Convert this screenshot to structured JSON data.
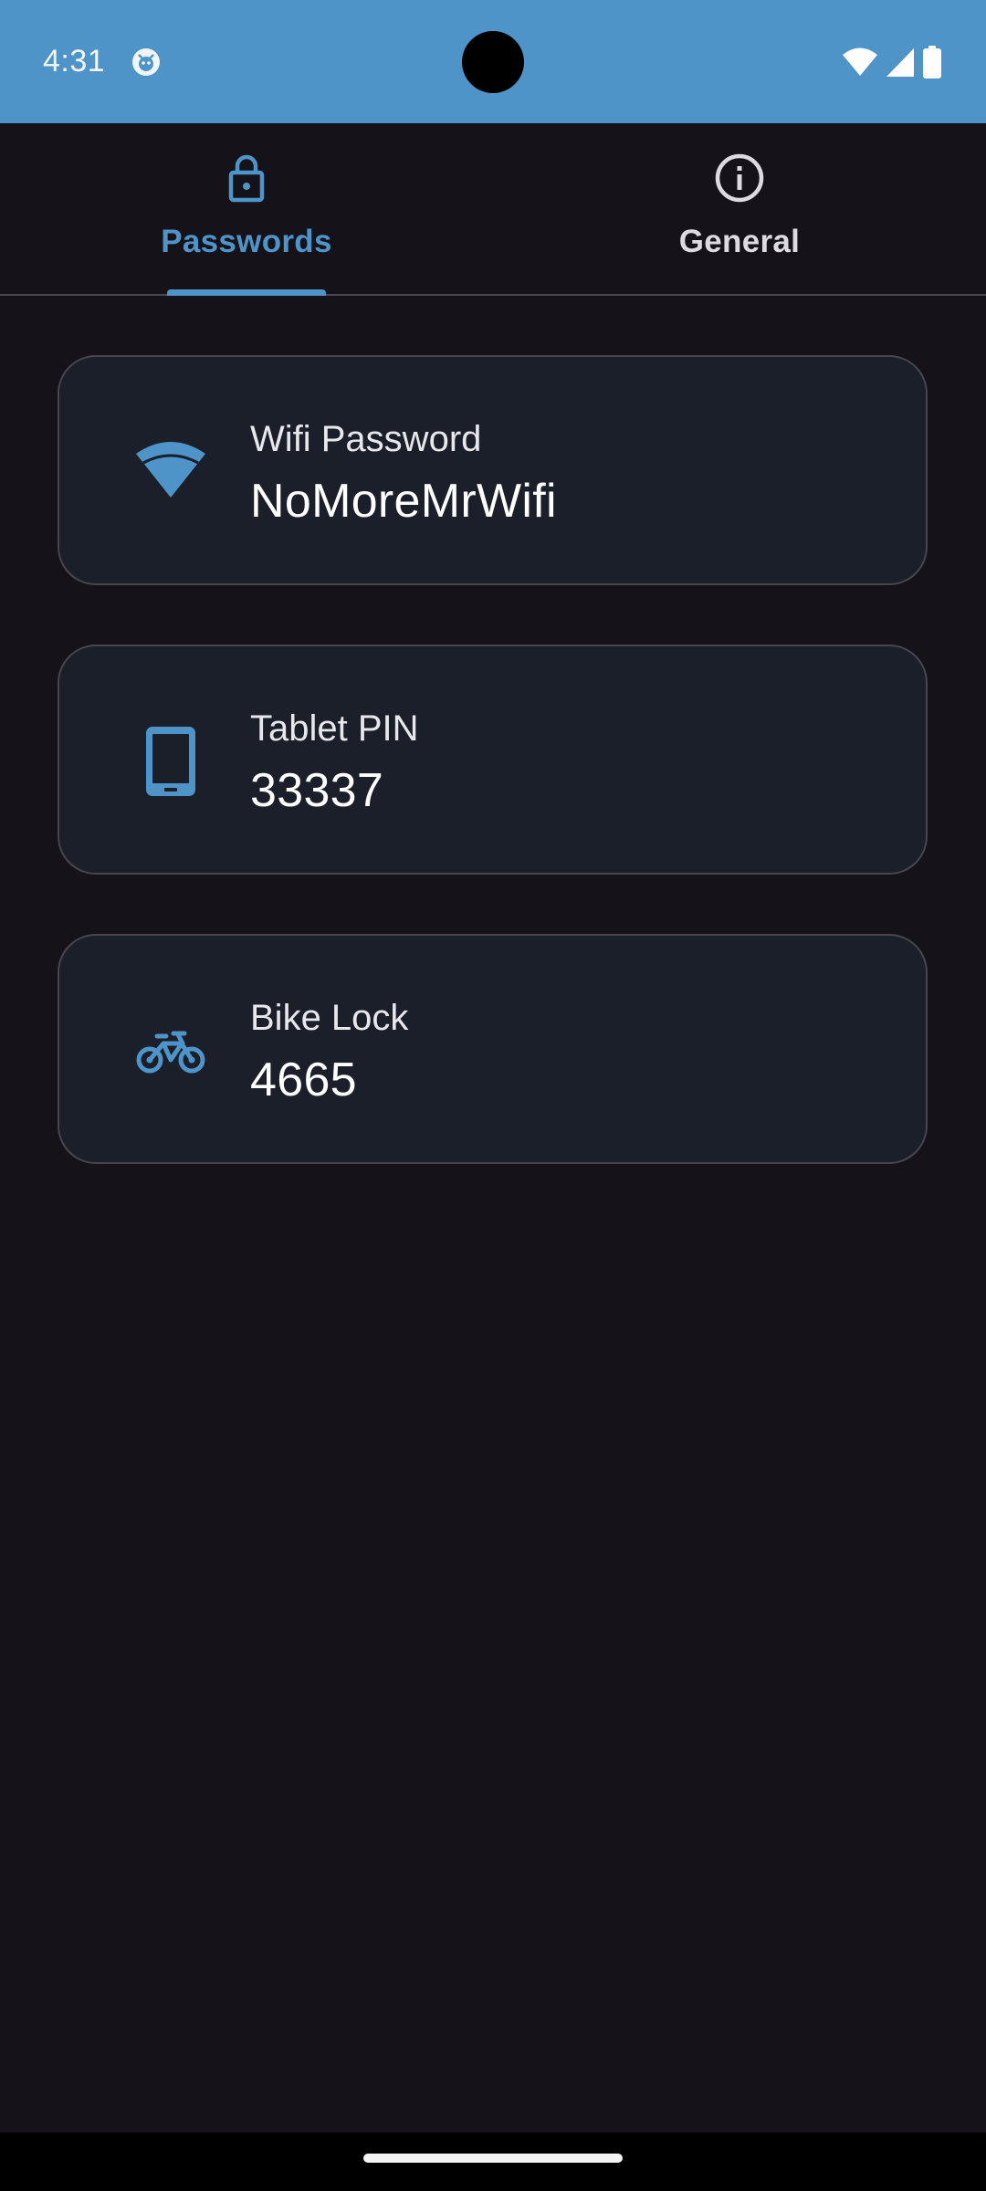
{
  "status_bar": {
    "time": "4:31",
    "background_color": "#4f94c9",
    "icons": [
      "app-notification-icon",
      "wifi-icon",
      "cellular-signal-icon",
      "battery-icon"
    ]
  },
  "tabs": [
    {
      "label": "Passwords",
      "icon": "lock-icon",
      "selected": true
    },
    {
      "label": "General",
      "icon": "info-icon",
      "selected": false
    }
  ],
  "accent_color": "#4f94c9",
  "entries": [
    {
      "label": "Wifi Password",
      "value": "NoMoreMrWifi",
      "icon": "wifi-icon"
    },
    {
      "label": "Tablet PIN",
      "value": "33337",
      "icon": "tablet-icon"
    },
    {
      "label": "Bike Lock",
      "value": "4665",
      "icon": "bike-icon"
    }
  ]
}
